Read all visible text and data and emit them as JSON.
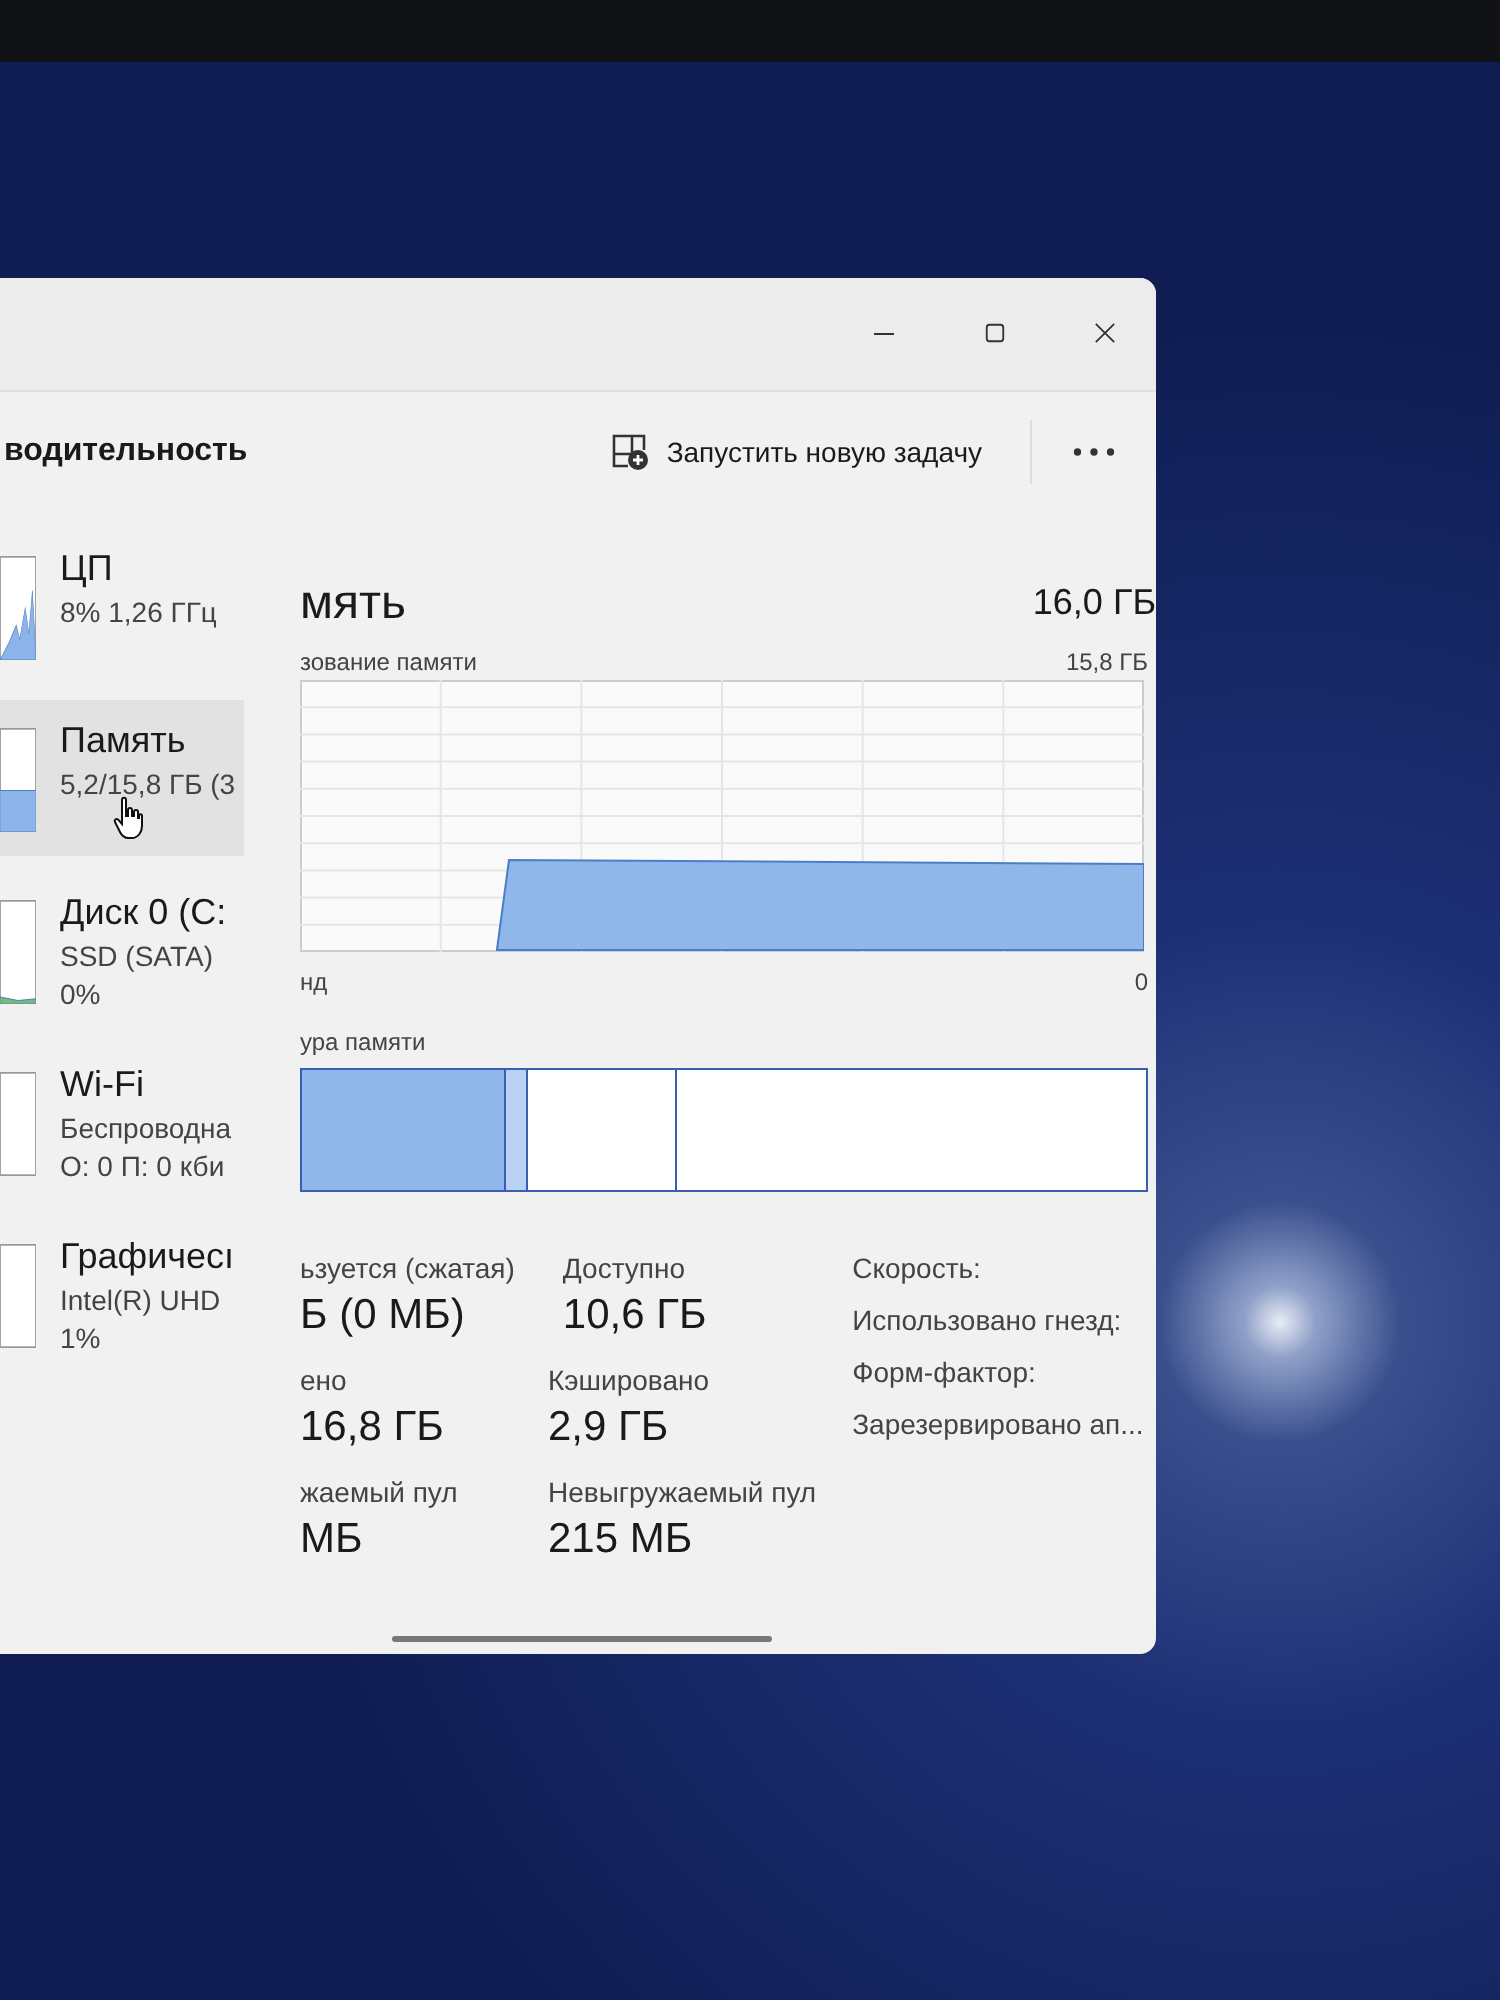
{
  "header": {
    "title": "водительность",
    "new_task_button": "Запустить новую задачу"
  },
  "sidebar": {
    "items": [
      {
        "kind": "cpu",
        "name": "ЦП",
        "lines": [
          "8%  1,26 ГГц"
        ],
        "selected": false
      },
      {
        "kind": "memory",
        "name": "Память",
        "lines": [
          "5,2/15,8 ГБ (3"
        ],
        "selected": true
      },
      {
        "kind": "disk",
        "name": "Диск 0 (C:",
        "lines": [
          "SSD (SATA)",
          "0%"
        ],
        "selected": false
      },
      {
        "kind": "wifi",
        "name": "Wi-Fi",
        "lines": [
          "Беспроводна",
          "О: 0 П: 0 кби"
        ],
        "selected": false
      },
      {
        "kind": "gpu",
        "name": "Графичесı",
        "lines": [
          "Intel(R) UHD",
          "1%"
        ],
        "selected": false
      }
    ]
  },
  "main": {
    "title": "мять",
    "total": "16,0 ГБ",
    "usage_graph": {
      "label": "зование памяти",
      "max": "15,8 ГБ",
      "left_label": "нд",
      "right_label": "0"
    },
    "composition_label": "ура памяти",
    "stat_rows": [
      [
        {
          "label": "ьзуется (сжатая)",
          "value": "Б (0 МБ)"
        },
        {
          "label": "Доступно",
          "value": "10,6 ГБ"
        }
      ],
      [
        {
          "label": "ено",
          "value": "16,8 ГБ"
        },
        {
          "label": "Кэшировано",
          "value": "2,9 ГБ"
        }
      ],
      [
        {
          "label": "жаемый пул",
          "value": "МБ"
        },
        {
          "label": "Невыгружаемый пул",
          "value": "215 МБ"
        }
      ]
    ],
    "details": [
      "Скорость:",
      "Использовано гнезд:",
      "Форм-фактор:",
      "Зарезервировано ап..."
    ]
  }
}
